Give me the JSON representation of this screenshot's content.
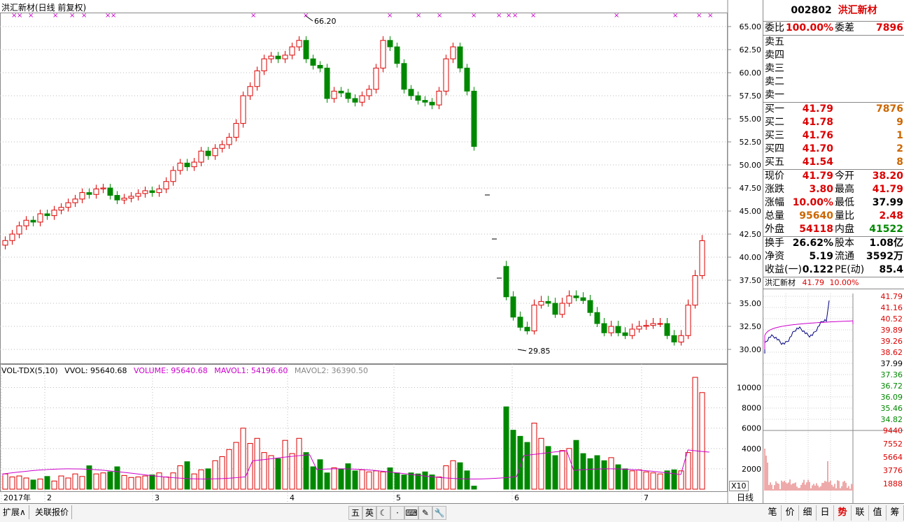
{
  "window": {
    "title": "洪汇新材(日线 前复权)"
  },
  "main_chart": {
    "y_ticks": [
      "65.00",
      "62.50",
      "60.00",
      "57.50",
      "55.00",
      "52.50",
      "50.00",
      "47.50",
      "45.00",
      "42.50",
      "40.00",
      "37.50",
      "35.00",
      "32.50",
      "30.00"
    ],
    "annotations": {
      "high": "66.20",
      "low": "29.85"
    },
    "x_labels": [
      "2017年",
      "2",
      "3",
      "4",
      "5",
      "6",
      "7"
    ]
  },
  "volume_panel": {
    "legend": {
      "name": "VOL-TDX(5,10)",
      "vvol": "VVOL: 95640.68",
      "volume": "VOLUME: 95640.68",
      "mavol1": "MAVOL1: 54196.60",
      "mavol2": "MAVOL2: 36390.50"
    },
    "y_ticks": [
      "10000",
      "8000",
      "6000",
      "4000",
      "2000"
    ],
    "scale_badge": "X10",
    "colors": {
      "volume": "#cc00cc",
      "mavol1": "#cc00cc",
      "mavol2": "#888888"
    }
  },
  "bottom_bar": {
    "tab_expand": "扩展∧",
    "tab_related": "关联报价",
    "period": "日线",
    "tools": [
      "五",
      "英",
      "☾",
      "·",
      "⌨",
      "✎",
      "🔧"
    ]
  },
  "quote_panel": {
    "code": "002802",
    "name": "洪汇新材",
    "weibi_label": "委比",
    "weibi_value": "100.00%",
    "weicha_label": "委差",
    "weicha_value": "7896",
    "sell": [
      {
        "label": "卖五",
        "price": "",
        "vol": ""
      },
      {
        "label": "卖四",
        "price": "",
        "vol": ""
      },
      {
        "label": "卖三",
        "price": "",
        "vol": ""
      },
      {
        "label": "卖二",
        "price": "",
        "vol": ""
      },
      {
        "label": "卖一",
        "price": "",
        "vol": ""
      }
    ],
    "buy": [
      {
        "label": "买一",
        "price": "41.79",
        "vol": "7876"
      },
      {
        "label": "买二",
        "price": "41.78",
        "vol": "9"
      },
      {
        "label": "买三",
        "price": "41.76",
        "vol": "1"
      },
      {
        "label": "买四",
        "price": "41.70",
        "vol": "2"
      },
      {
        "label": "买五",
        "price": "41.54",
        "vol": "8"
      }
    ],
    "stats1": [
      {
        "l1": "现价",
        "v1": "41.79",
        "l2": "今开",
        "v2": "38.20"
      },
      {
        "l1": "涨跌",
        "v1": "3.80",
        "l2": "最高",
        "v2": "41.79"
      },
      {
        "l1": "涨幅",
        "v1": "10.00%",
        "l2": "最低",
        "v2": "37.99"
      },
      {
        "l1": "总量",
        "v1": "95640",
        "l2": "量比",
        "v2": "2.48"
      },
      {
        "l1": "外盘",
        "v1": "54118",
        "l2": "内盘",
        "v2": "41522"
      }
    ],
    "stats2": [
      {
        "l1": "换手",
        "v1": "26.62%",
        "l2": "股本",
        "v2": "1.08亿"
      },
      {
        "l1": "净资",
        "v1": "5.19",
        "l2": "流通",
        "v2": "3592万"
      },
      {
        "l1": "收益(一)",
        "v1": "0.122",
        "l2": "PE(动)",
        "v2": "85.4"
      }
    ],
    "mini_chart": {
      "name": "洪汇新材",
      "price": "41.79",
      "pct": "10.00%",
      "price_ticks": [
        "41.79",
        "41.16",
        "40.52",
        "39.89",
        "39.26",
        "38.62",
        "37.99",
        "37.36",
        "36.72",
        "36.09",
        "35.46",
        "34.82"
      ],
      "vol_ticks": [
        "9440",
        "7552",
        "5664",
        "3776",
        "1888"
      ]
    },
    "tabs": [
      "笔",
      "价",
      "细",
      "日",
      "势",
      "联",
      "值",
      "筹"
    ],
    "active_tab": "势"
  }
}
